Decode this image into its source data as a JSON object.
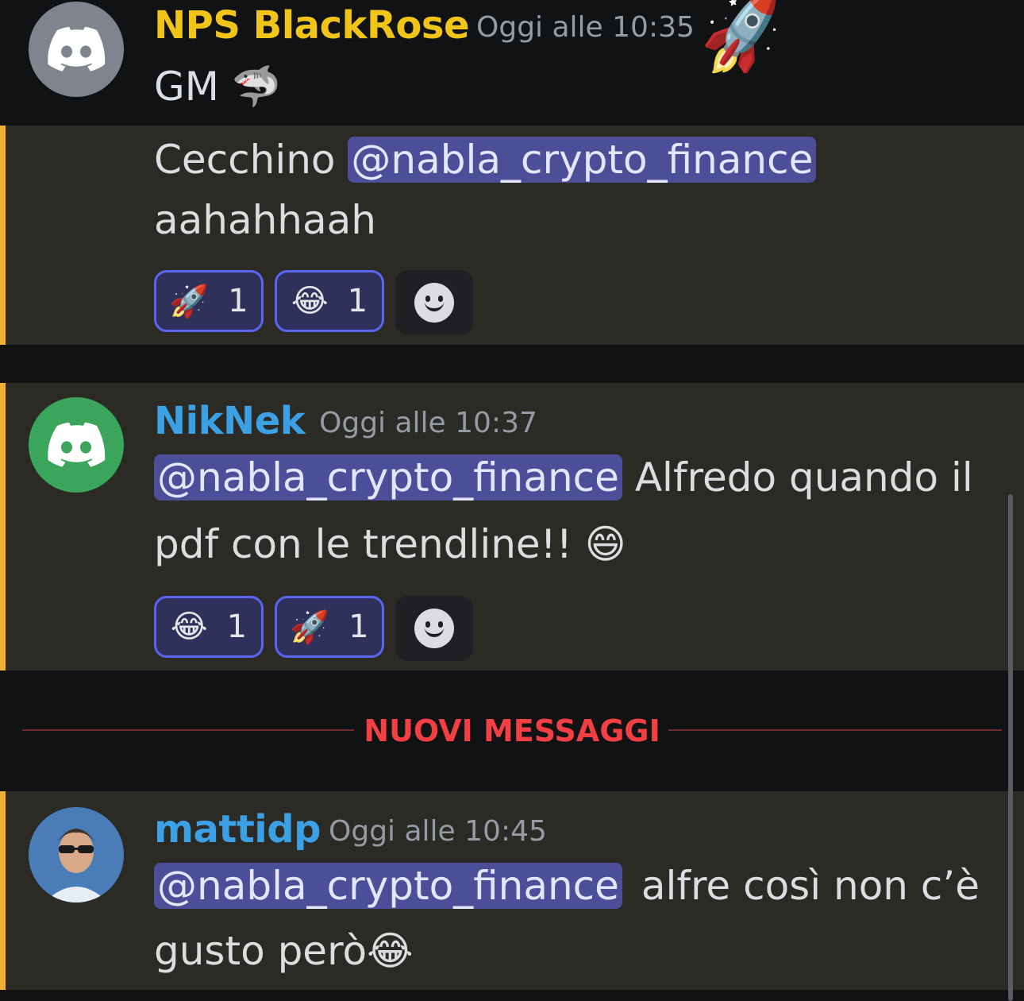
{
  "messages": [
    {
      "author": "NPS BlackRose",
      "author_color": "#f0c419",
      "timestamp": "Oggi alle 10:35",
      "avatar_color": "#80848e",
      "lines": [
        "GM 🦈"
      ]
    },
    {
      "continuation": true,
      "mention": "@nabla_crypto_finance",
      "line1_prefix": "Cecchino",
      "line2": "aahahhaah",
      "reactions": [
        {
          "emoji": "🚀",
          "count": "1"
        },
        {
          "emoji": "😂",
          "count": "1"
        }
      ]
    },
    {
      "author": "NikNek",
      "author_color": "#3ba1e4",
      "timestamp": "Oggi alle 10:37",
      "avatar_color": "#3ba55c",
      "mention": "@nabla_crypto_finance",
      "line1_suffix": "Alfredo quando il",
      "line2": "pdf con le trendline!! 😄",
      "reactions": [
        {
          "emoji": "😂",
          "count": "1"
        },
        {
          "emoji": "🚀",
          "count": "1"
        }
      ]
    },
    {
      "author": "mattidp",
      "author_color": "#3ba1e4",
      "timestamp": "Oggi alle 10:45",
      "mention": "@nabla_crypto_finance",
      "line1_suffix": "alfre così non c’è",
      "line2": "gusto però😂"
    }
  ],
  "divider_label": "NUOVI MESSAGGI",
  "decor": {
    "rocket": "🚀"
  }
}
